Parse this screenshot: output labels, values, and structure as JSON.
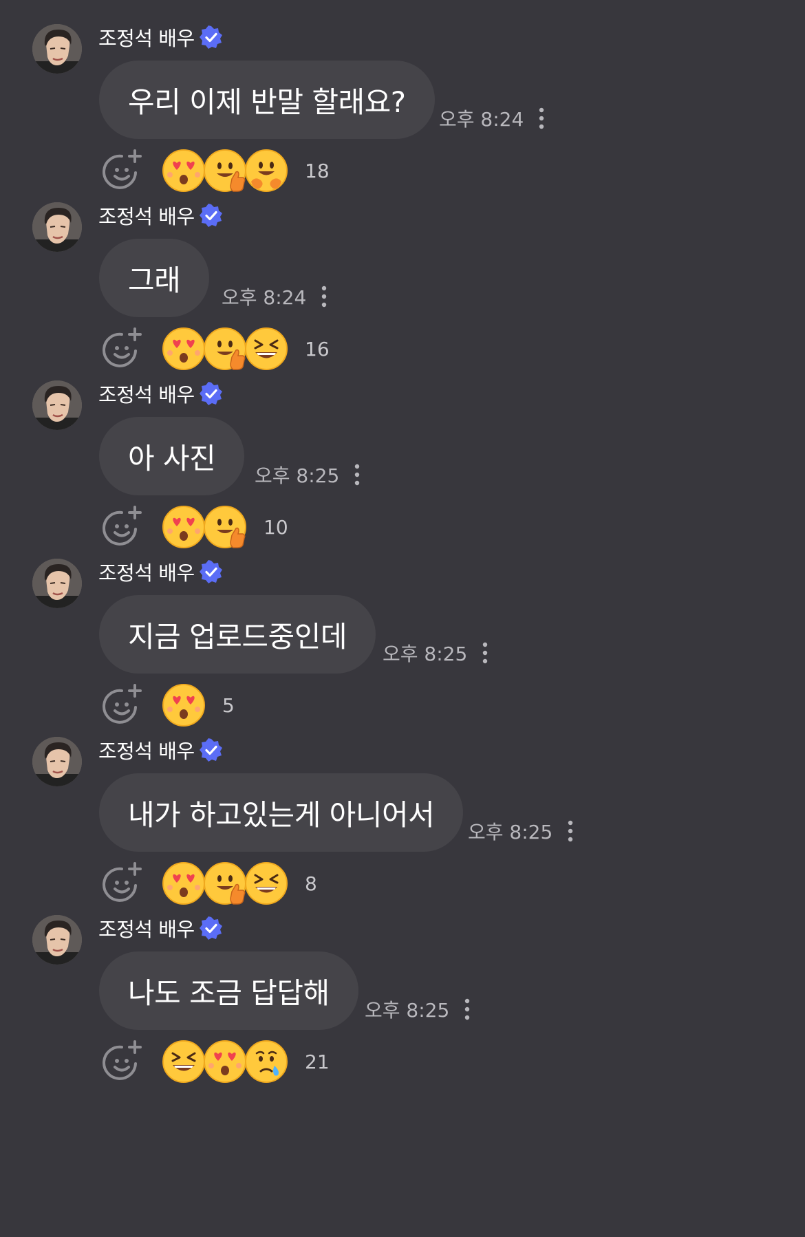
{
  "messages": [
    {
      "sender": "조정석 배우",
      "text": "우리 이제 반말 할래요?",
      "time": "오후 8:24",
      "reactions": [
        "heart-eyes",
        "thumbs-up-face",
        "hugging-face"
      ],
      "count": "18"
    },
    {
      "sender": "조정석 배우",
      "text": "그래",
      "time": "오후 8:24",
      "reactions": [
        "heart-eyes",
        "thumbs-up-face",
        "grinning-squint"
      ],
      "count": "16"
    },
    {
      "sender": "조정석 배우",
      "text": "아 사진",
      "time": "오후 8:25",
      "reactions": [
        "heart-eyes",
        "thumbs-up-face"
      ],
      "count": "10"
    },
    {
      "sender": "조정석 배우",
      "text": "지금 업로드중인데",
      "time": "오후 8:25",
      "reactions": [
        "heart-eyes"
      ],
      "count": "5"
    },
    {
      "sender": "조정석 배우",
      "text": "내가 하고있는게 아니어서",
      "time": "오후 8:25",
      "reactions": [
        "heart-eyes",
        "thumbs-up-face",
        "grinning-squint"
      ],
      "count": "8"
    },
    {
      "sender": "조정석 배우",
      "text": "나도 조금 답답해",
      "time": "오후 8:25",
      "reactions": [
        "grinning-squint",
        "heart-eyes",
        "crying-face"
      ],
      "count": "21"
    }
  ],
  "colors": {
    "background": "#38373d",
    "bubble": "#454449",
    "verified_badge": "#5b6df6",
    "timestamp": "#b9b8bd",
    "emoji_yellow": "#ffc93c"
  },
  "icons": {
    "avatar": "profile-photo",
    "verified": "verified-badge-icon",
    "add_reaction": "add-reaction-icon",
    "more": "more-vertical-icon"
  }
}
